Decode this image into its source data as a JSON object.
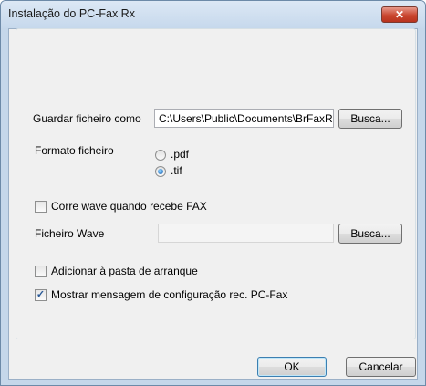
{
  "window": {
    "title": "Instalação do PC-Fax Rx",
    "close_glyph": "✕"
  },
  "save_as": {
    "label": "Guardar ficheiro como",
    "path": "C:\\Users\\Public\\Documents\\BrFaxRx",
    "browse_label": "Busca..."
  },
  "format": {
    "label": "Formato ficheiro",
    "options": [
      {
        "label": ".pdf",
        "selected": false
      },
      {
        "label": ".tif",
        "selected": true
      }
    ]
  },
  "run_wave": {
    "label": "Corre wave quando recebe FAX",
    "checked": false
  },
  "wave_file": {
    "label": "Ficheiro Wave",
    "value": "",
    "browse_label": "Busca..."
  },
  "add_startup": {
    "label": "Adicionar à pasta de arranque",
    "checked": false
  },
  "show_setup_message": {
    "label": "Mostrar mensagem de configuração rec. PC-Fax",
    "checked": true,
    "check_glyph": "✓"
  },
  "footer": {
    "ok_label": "OK",
    "cancel_label": "Cancelar"
  }
}
